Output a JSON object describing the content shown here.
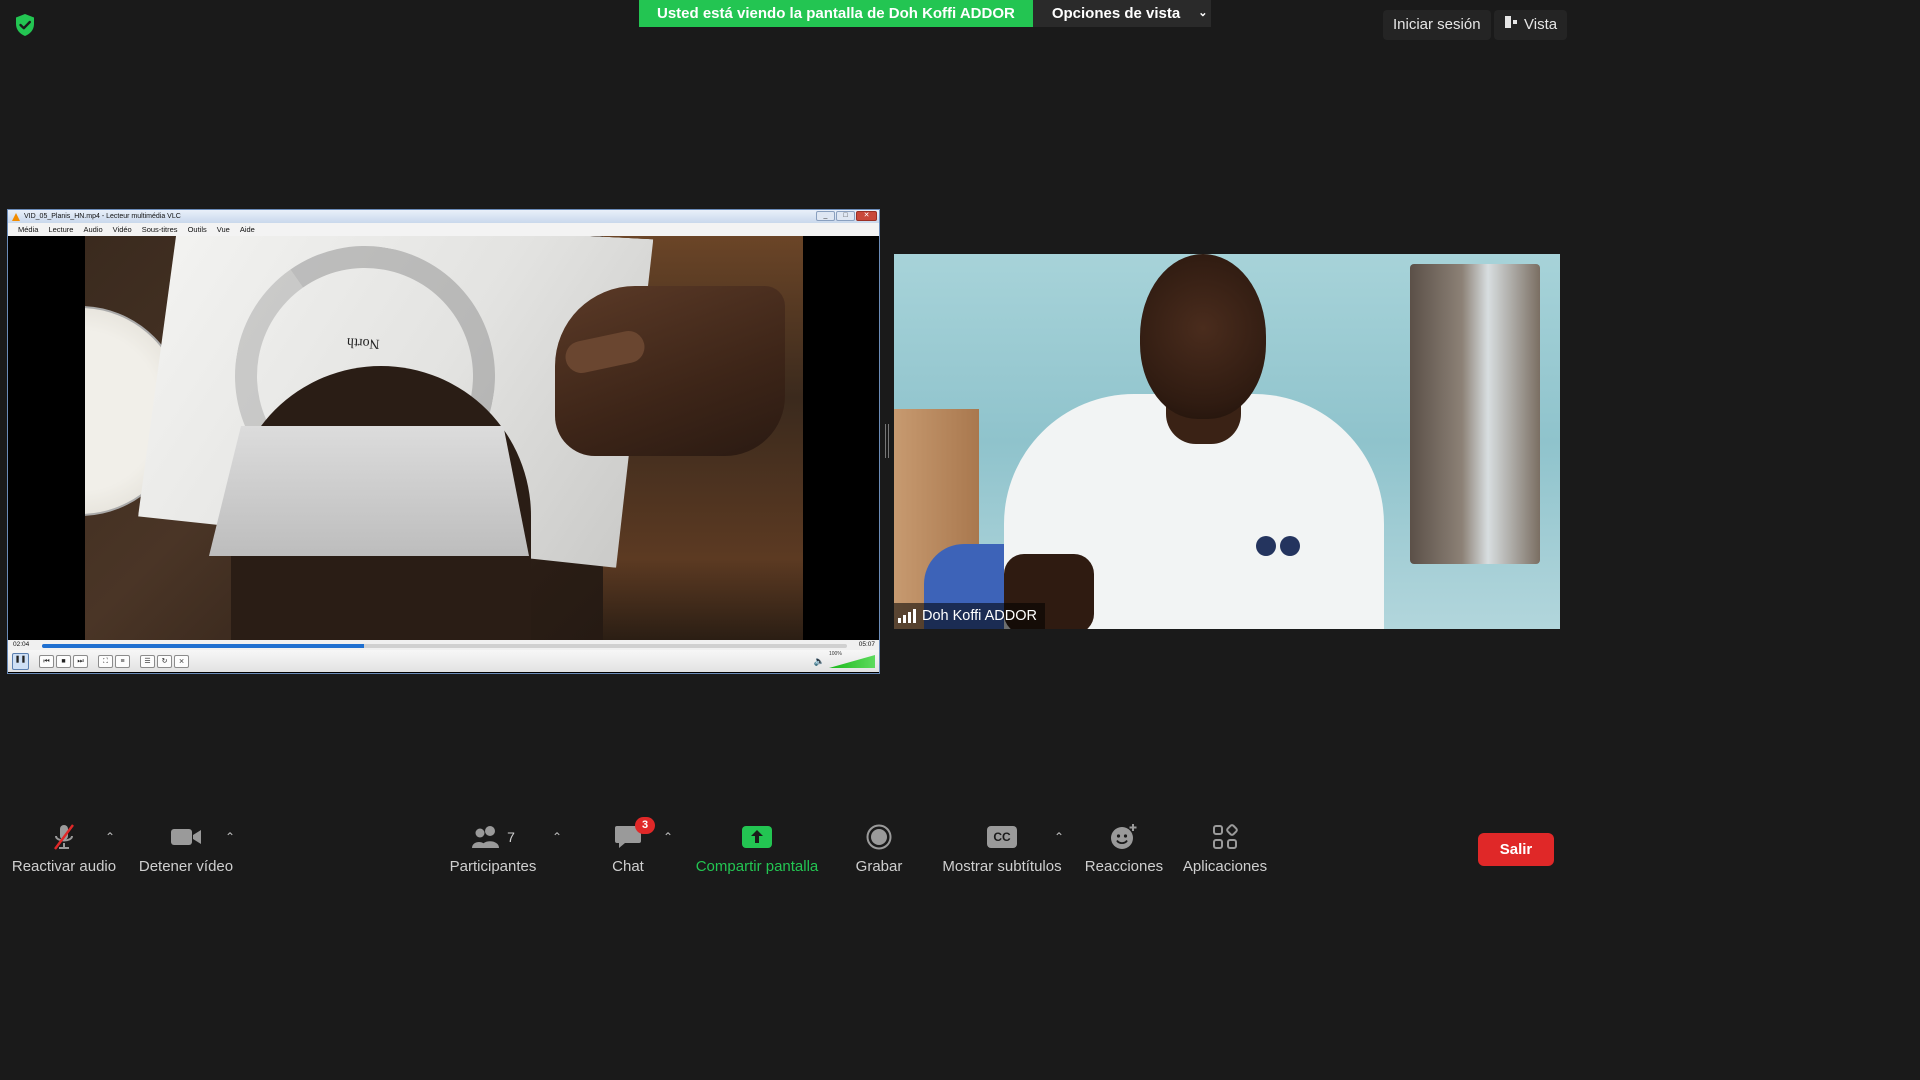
{
  "banner": {
    "sharing_text": "Usted está viendo la pantalla de Doh Koffi ADDOR",
    "view_options_label": "Opciones de vista"
  },
  "top_right": {
    "signin_label": "Iniciar sesión",
    "view_label": "Vista"
  },
  "vlc": {
    "title": "VID_05_Planis_HN.mp4 - Lecteur multimédia VLC",
    "menu": [
      "Média",
      "Lecture",
      "Audio",
      "Vidéo",
      "Sous-titres",
      "Outils",
      "Vue",
      "Aide"
    ],
    "time_elapsed": "02:04",
    "time_total": "05:07",
    "progress_fraction": 0.4,
    "volume_label": "100%",
    "video_text": "North"
  },
  "camera": {
    "participant_name": "Doh Koffi ADDOR"
  },
  "toolbar": {
    "unmute_label": "Reactivar audio",
    "video_label": "Detener vídeo",
    "participants_label": "Participantes",
    "participants_count": "7",
    "chat_label": "Chat",
    "chat_badge": "3",
    "share_label": "Compartir pantalla",
    "record_label": "Grabar",
    "captions_label": "Mostrar subtítulos",
    "captions_icon_text": "CC",
    "reactions_label": "Reacciones",
    "apps_label": "Aplicaciones",
    "leave_label": "Salir"
  },
  "colors": {
    "accent_green": "#23c552",
    "leave_red": "#e02828",
    "background": "#1a1a1a"
  }
}
